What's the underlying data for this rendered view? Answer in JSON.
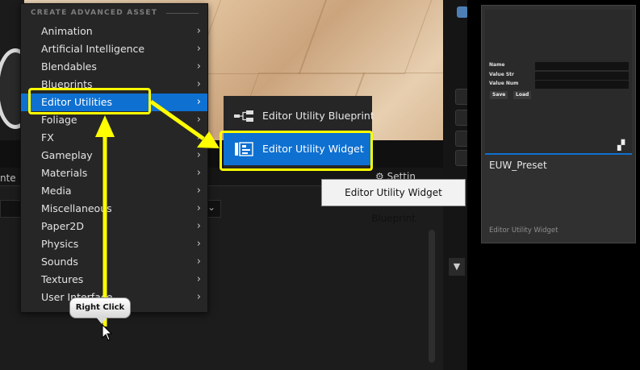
{
  "menu": {
    "header": "CREATE ADVANCED ASSET",
    "items": [
      {
        "label": "Animation"
      },
      {
        "label": "Artificial Intelligence"
      },
      {
        "label": "Blendables"
      },
      {
        "label": "Blueprints"
      },
      {
        "label": "Editor Utilities"
      },
      {
        "label": "Foliage"
      },
      {
        "label": "FX"
      },
      {
        "label": "Gameplay"
      },
      {
        "label": "Materials"
      },
      {
        "label": "Media"
      },
      {
        "label": "Miscellaneous"
      },
      {
        "label": "Paper2D"
      },
      {
        "label": "Physics"
      },
      {
        "label": "Sounds"
      },
      {
        "label": "Textures"
      },
      {
        "label": "User Interface"
      }
    ],
    "active_index": 4
  },
  "submenu": {
    "items": [
      {
        "label": "Editor Utility Blueprint",
        "icon": "blueprint-graph-icon"
      },
      {
        "label": "Editor Utility Widget",
        "icon": "widget-layout-icon"
      }
    ],
    "active_index": 1
  },
  "tooltip": {
    "text": "Editor Utility Widget Blueprint"
  },
  "callout": {
    "text": "Right Click"
  },
  "editor": {
    "settings_label": "Settin",
    "content_label": "nte"
  },
  "widget_card": {
    "name": "EUW_Preset",
    "type": "Editor Utility Widget",
    "fields": [
      {
        "label": "Name"
      },
      {
        "label": "Value Str"
      },
      {
        "label": "Value Num"
      }
    ],
    "buttons": [
      {
        "label": "Save"
      },
      {
        "label": "Load"
      }
    ]
  },
  "colors": {
    "highlight": "#ffff00",
    "accent": "#0e70d1",
    "menu_bg": "#262626"
  }
}
